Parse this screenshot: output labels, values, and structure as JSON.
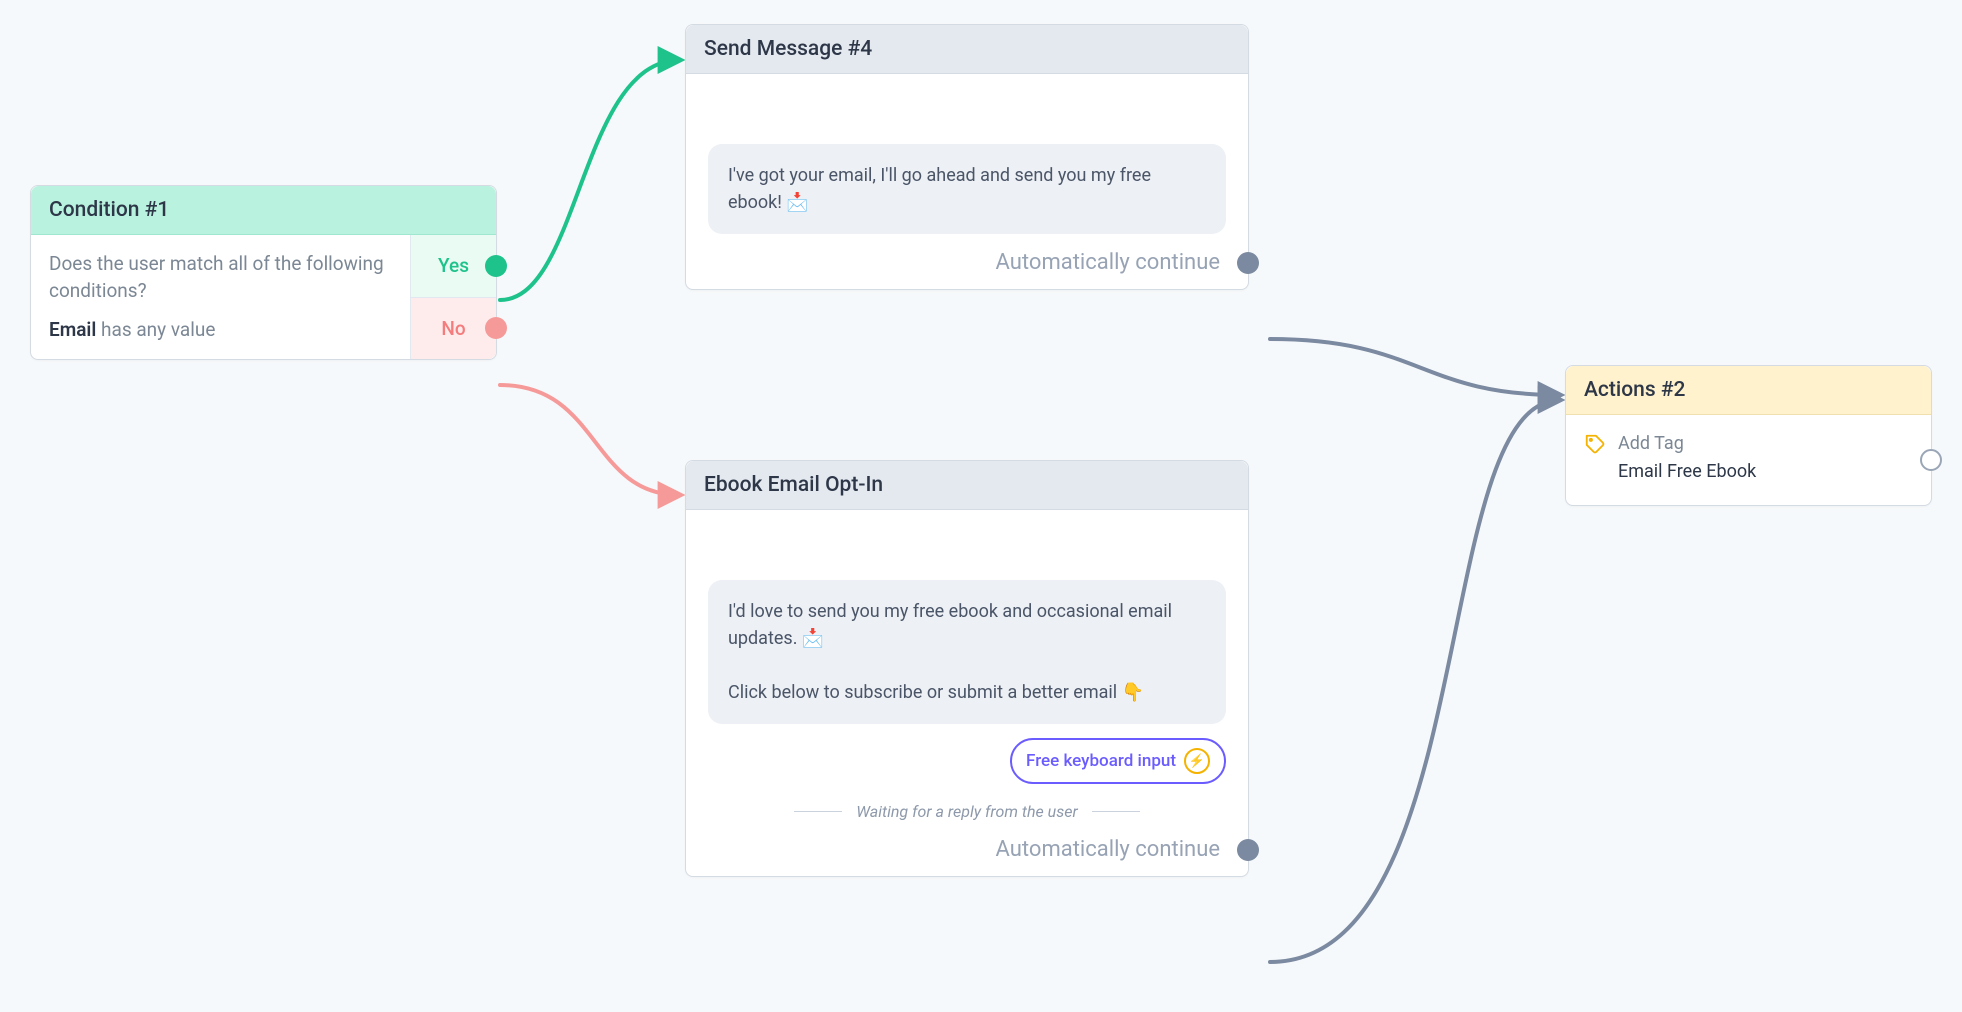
{
  "condition": {
    "title": "Condition #1",
    "question": "Does the user match all of the following conditions?",
    "rule_field": "Email",
    "rule_operator": "has any value",
    "yes_label": "Yes",
    "no_label": "No"
  },
  "send_message": {
    "title": "Send Message #4",
    "bubble_text": "I've got your email, I'll go ahead and send you my free ebook! 📩",
    "continue_label": "Automatically continue"
  },
  "optin": {
    "title": "Ebook Email Opt-In",
    "bubble_line1": "I'd love to send you my free ebook and occasional email updates. 📩",
    "bubble_line2": "Click below to subscribe or submit a better email 👇",
    "chip_label": "Free keyboard input",
    "waiting_text": "Waiting for a reply from the user",
    "continue_label": "Automatically continue"
  },
  "actions": {
    "title": "Actions #2",
    "action_label": "Add Tag",
    "action_value": "Email Free Ebook"
  },
  "colors": {
    "green": "#1ec28b",
    "red": "#f69a99",
    "grey_connector": "#7b8aa0",
    "purple": "#6b5cff",
    "yellow": "#f5b301"
  }
}
